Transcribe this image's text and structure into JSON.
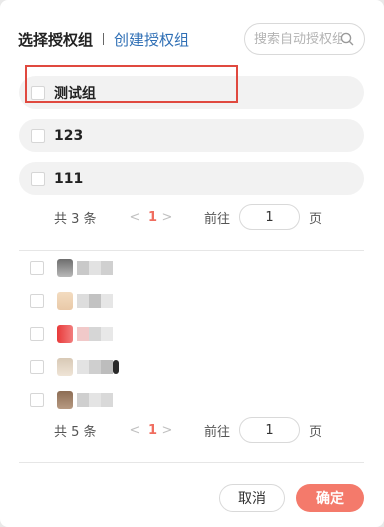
{
  "header": {
    "title": "选择授权组",
    "create_link": "创建授权组",
    "search_placeholder": "搜索自动授权组"
  },
  "groups": {
    "items": [
      {
        "label": "测试组",
        "checked": false
      },
      {
        "label": "123",
        "checked": false
      },
      {
        "label": "111",
        "checked": false
      }
    ],
    "pagination": {
      "total": "共 3 条",
      "current_page": "1",
      "goto_label": "前往",
      "goto_value": "1",
      "page_unit": "页"
    }
  },
  "members": {
    "count": 5,
    "pagination": {
      "total": "共 5 条",
      "current_page": "1",
      "goto_label": "前往",
      "goto_value": "1",
      "page_unit": "页"
    }
  },
  "footer": {
    "cancel_label": "取消",
    "confirm_label": "确定"
  },
  "colors": {
    "accent": "#f47a6b",
    "link": "#2f6fb5",
    "highlight_box": "#e0493f",
    "current_page": "#f06d5f"
  }
}
